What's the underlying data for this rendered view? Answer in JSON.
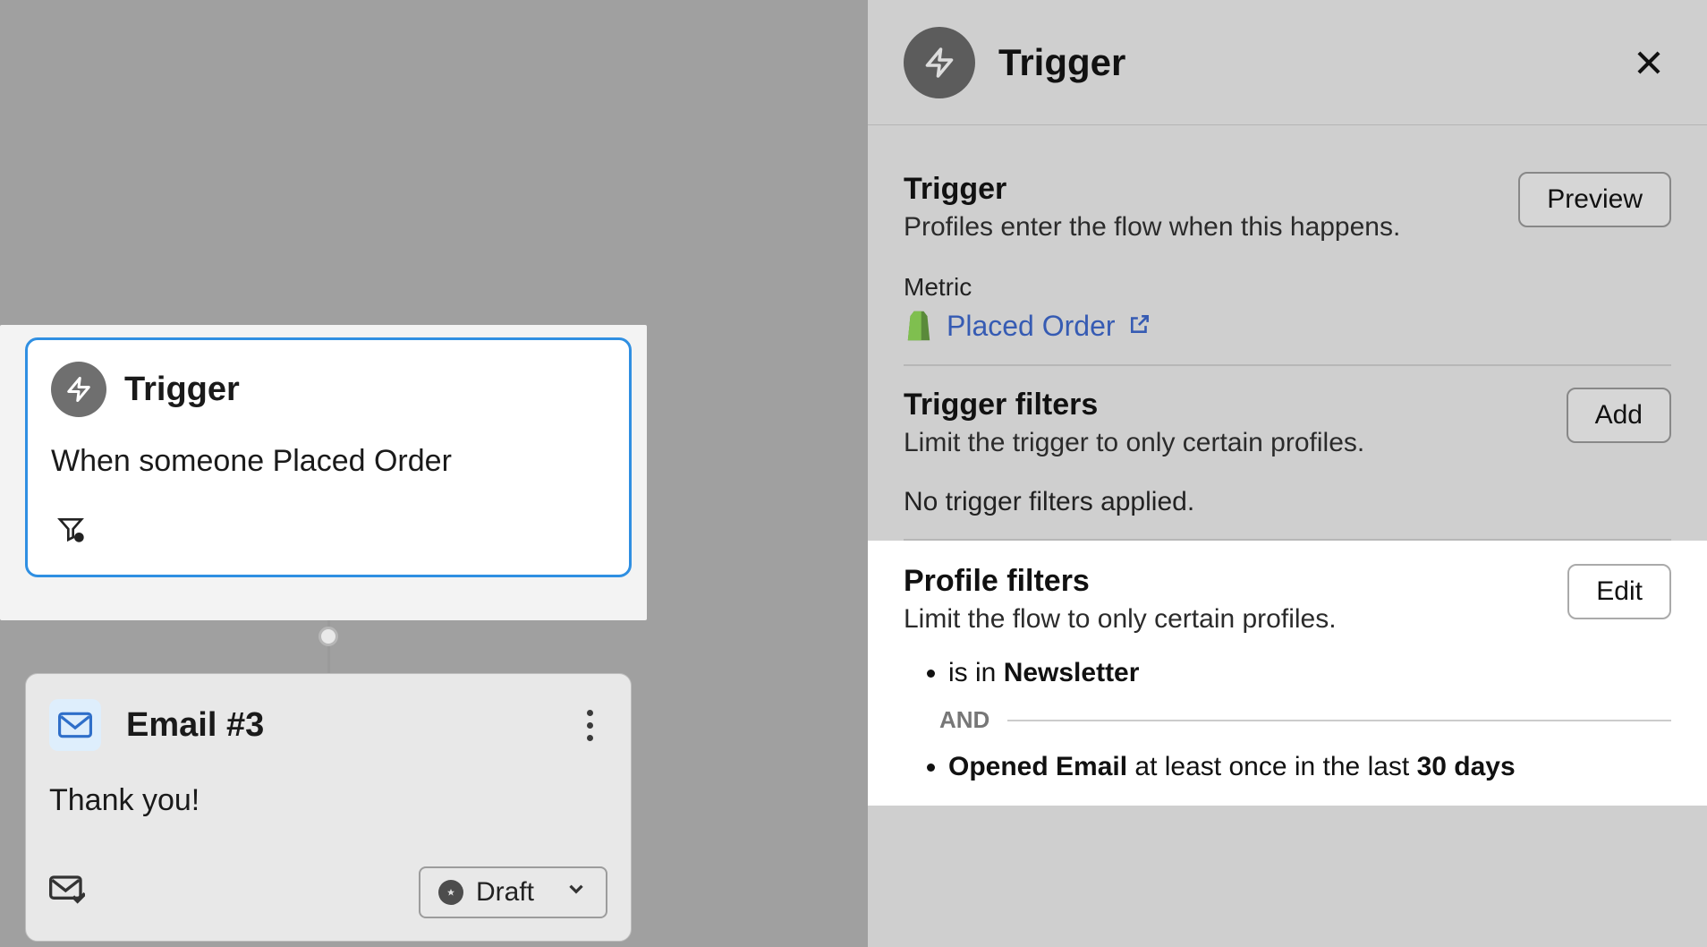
{
  "canvas": {
    "trigger_card": {
      "title": "Trigger",
      "description": "When someone Placed Order"
    },
    "email_card": {
      "title": "Email #3",
      "subject": "Thank you!",
      "status_label": "Draft"
    }
  },
  "panel": {
    "header_title": "Trigger",
    "trigger_section": {
      "title": "Trigger",
      "subtitle": "Profiles enter the flow when this happens.",
      "preview_button": "Preview",
      "metric_label": "Metric",
      "metric_link": "Placed Order"
    },
    "trigger_filters_section": {
      "title": "Trigger filters",
      "subtitle": "Limit the trigger to only certain profiles.",
      "add_button": "Add",
      "empty_text": "No trigger filters applied."
    },
    "profile_filters_section": {
      "title": "Profile filters",
      "subtitle": "Limit the flow to only certain profiles.",
      "edit_button": "Edit",
      "conditions": [
        {
          "prefix": "is in ",
          "bold1": "Newsletter",
          "mid": "",
          "bold2": ""
        },
        {
          "prefix": "",
          "bold1": "Opened Email",
          "mid": " at least once in the last ",
          "bold2": "30 days"
        }
      ],
      "joiner": "AND"
    }
  }
}
